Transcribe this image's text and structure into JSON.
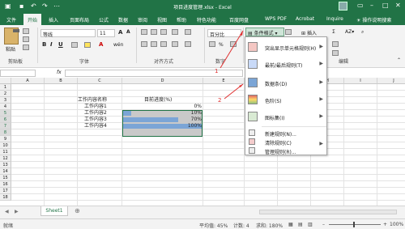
{
  "titlebar": {
    "filename": "项目进度管理.xlsx  -  Excel",
    "autosave_icon": "autosave-icon",
    "undo_icon": "undo-icon",
    "redo_icon": "redo-icon"
  },
  "tabs": [
    "文件",
    "开始",
    "插入",
    "页面布局",
    "公式",
    "数据",
    "审阅",
    "视图",
    "帮助",
    "特色功能",
    "百度网盘",
    "WPS PDF",
    "Acrobat",
    "Inquire"
  ],
  "search_tab": "操作说明搜索",
  "ribbon": {
    "clipboard": {
      "paste": "粘贴",
      "label": "剪贴板"
    },
    "font": {
      "name": "等线",
      "size": "11",
      "label": "字体",
      "bold": "B",
      "italic": "I",
      "underline": "U"
    },
    "alignment": {
      "label": "对齐方式"
    },
    "number": {
      "format": "百分比",
      "label": "数字"
    },
    "styles": {
      "cf_button": "条件格式"
    },
    "cells": {
      "insert": "插入"
    },
    "editing": {
      "label": "编辑"
    }
  },
  "columns": [
    "A",
    "B",
    "C",
    "D",
    "E",
    "F",
    "G",
    "H",
    "I",
    "J",
    "K",
    "L",
    "M",
    "N",
    "O",
    "P",
    "Q"
  ],
  "rows": [
    "1",
    "2",
    "3",
    "4",
    "5",
    "6",
    "7",
    "8",
    "9",
    "10",
    "11",
    "12",
    "13",
    "14",
    "15",
    "16",
    "17",
    "18"
  ],
  "table": {
    "header": {
      "name": "工作内容名称",
      "progress": "目前进度(%)"
    },
    "items": [
      {
        "name": "工作内容1",
        "progress": "0%",
        "value": 0
      },
      {
        "name": "工作内容2",
        "progress": "10%",
        "value": 10
      },
      {
        "name": "工作内容3",
        "progress": "70%",
        "value": 70
      },
      {
        "name": "工作内容4",
        "progress": "100%",
        "value": 100
      }
    ]
  },
  "menu": {
    "items": [
      {
        "label": "突出显示单元格规则(H)",
        "icon": "highlight-cells-icon"
      },
      {
        "label": "最前/最后规则(T)",
        "icon": "top-bottom-icon"
      },
      {
        "label": "数据条(D)",
        "icon": "data-bars-icon"
      },
      {
        "label": "色阶(S)",
        "icon": "color-scales-icon"
      },
      {
        "label": "图标集(I)",
        "icon": "icon-sets-icon"
      }
    ],
    "small_items": [
      {
        "label": "新建规则(N)...",
        "icon": "new-rule-icon"
      },
      {
        "label": "清除规则(C)",
        "icon": "clear-rules-icon"
      },
      {
        "label": "管理规则(R)...",
        "icon": "manage-rules-icon"
      }
    ]
  },
  "annotations": {
    "one": "1",
    "two": "2"
  },
  "sheet_tab": "Sheet1",
  "status": {
    "average": "平均值: 45%",
    "count": "计数: 4",
    "sum": "求和: 180%",
    "zoom": "100%",
    "ready": "就绪"
  },
  "colors": {
    "accent": "#217346",
    "annotation": "#e03030",
    "databar": "#7ba5d6"
  }
}
